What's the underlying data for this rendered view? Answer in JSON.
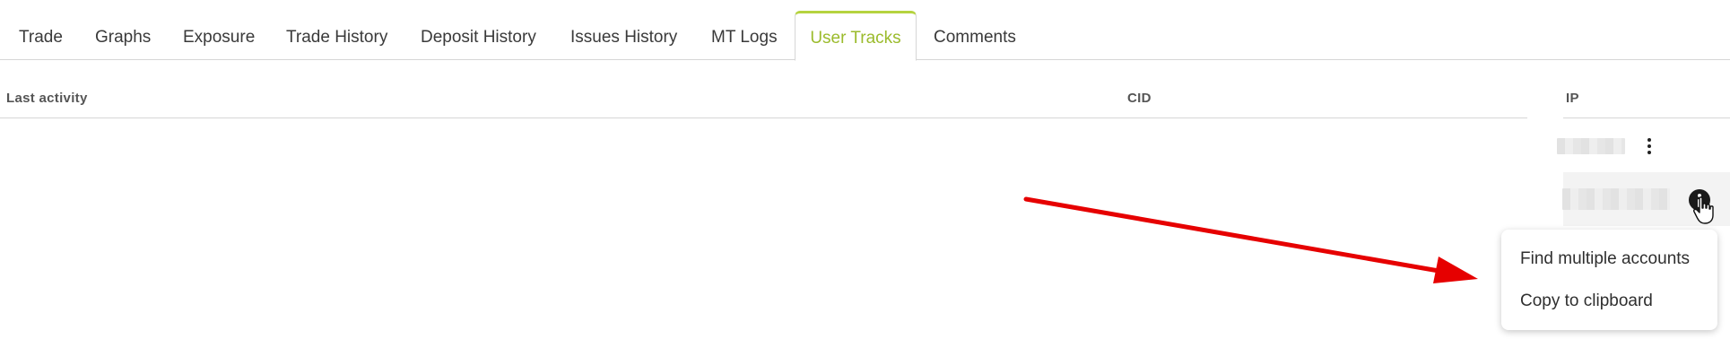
{
  "tabs": [
    {
      "label": "Trade",
      "active": false
    },
    {
      "label": "Graphs",
      "active": false
    },
    {
      "label": "Exposure",
      "active": false
    },
    {
      "label": "Trade History",
      "active": false
    },
    {
      "label": "Deposit History",
      "active": false
    },
    {
      "label": "Issues History",
      "active": false
    },
    {
      "label": "MT Logs",
      "active": false
    },
    {
      "label": "User Tracks",
      "active": true
    },
    {
      "label": "Comments",
      "active": false
    }
  ],
  "table": {
    "columns": [
      "Last activity",
      "CID",
      "IP"
    ]
  },
  "context_menu": {
    "items": [
      "Find multiple accounts",
      "Copy to clipboard"
    ]
  },
  "colors": {
    "active_tab": "#9bbb2c",
    "active_tab_border": "#b5d33f",
    "annotation_arrow": "#e60000"
  },
  "icons": [
    "kebab-menu-icon",
    "info-icon",
    "hand-cursor-icon",
    "annotation-arrow"
  ]
}
